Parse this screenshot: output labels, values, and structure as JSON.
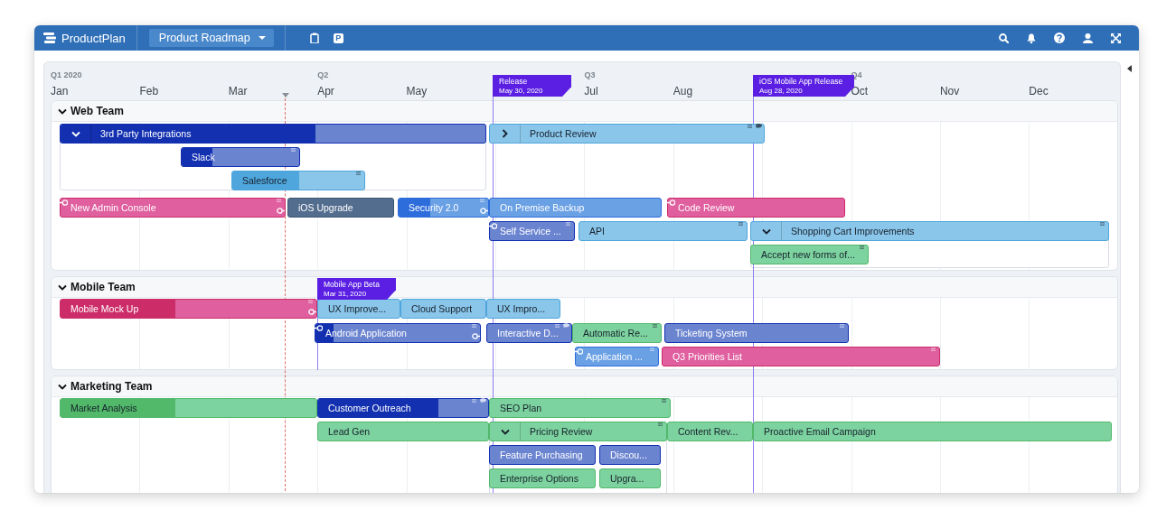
{
  "app": {
    "logo": "ProductPlan",
    "roadmap_menu": "Product Roadmap",
    "toolbar_badge": "P"
  },
  "timeline": {
    "quarters": [
      "Q1 2020",
      "Q2",
      "Q3",
      "Q4"
    ],
    "months": [
      "Jan",
      "Feb",
      "Mar",
      "Apr",
      "May",
      "Jul",
      "Aug",
      "Oct",
      "Nov",
      "Dec"
    ]
  },
  "milestones": [
    {
      "title": "Release",
      "date": "May 30, 2020"
    },
    {
      "title": "iOS Mobile App Release",
      "date": "Aug 28, 2020"
    },
    {
      "title": "Mobile App Beta",
      "date": "Mar 31, 2020"
    }
  ],
  "lanes": [
    {
      "name": "Web Team",
      "expanded": true,
      "bars": [
        {
          "label": "3rd Party Integrations",
          "color": "#6b84d0",
          "level": 0.6,
          "kind": "parent",
          "expanded": true
        },
        {
          "label": "Slack",
          "color": "#6b84d0",
          "level": 0.26,
          "kind": "bar",
          "handle": true
        },
        {
          "label": "Salesforce",
          "color": "#8ac6ea",
          "level": 0.51,
          "kind": "bar",
          "handle": true
        },
        {
          "label": "Product Review",
          "color": "#8ac6ea",
          "kind": "parent",
          "expanded": false,
          "handle": true,
          "comment": true
        },
        {
          "label": "New Admin Console",
          "color": "#df5f9f",
          "kind": "bar",
          "handle": true,
          "dependency_start": true,
          "dependency_end": true
        },
        {
          "label": "iOS Upgrade",
          "color": "#536d8f",
          "kind": "bar"
        },
        {
          "label": "Security 2.0",
          "color": "#6aa0e4",
          "level": 0.35,
          "kind": "bar",
          "handle": true,
          "dependency_end": true
        },
        {
          "label": "On Premise Backup",
          "color": "#6aa0e4",
          "kind": "bar"
        },
        {
          "label": "Code Review",
          "color": "#df5f9f",
          "kind": "bar",
          "dependency_start": true
        },
        {
          "label": "Self Service ...",
          "color": "#6b84d0",
          "kind": "bar",
          "handle": true,
          "dependency_start": true
        },
        {
          "label": "API",
          "color": "#8ac6ea",
          "kind": "bar",
          "handle": true
        },
        {
          "label": "Shopping Cart Improvements",
          "color": "#8ac6ea",
          "kind": "parent",
          "expanded": true,
          "handle": true
        },
        {
          "label": "Accept new forms of...",
          "color": "#7dd3a0",
          "kind": "bar",
          "handle": true
        }
      ]
    },
    {
      "name": "Mobile Team",
      "expanded": true,
      "bars": [
        {
          "label": "Mobile Mock Up",
          "color": "#df5f9f",
          "level": 0.45,
          "kind": "bar",
          "handle": true,
          "dependency_end": true
        },
        {
          "label": "UX Improve...",
          "color": "#8ac6ea",
          "kind": "bar"
        },
        {
          "label": "Cloud Support",
          "color": "#8ac6ea",
          "kind": "bar"
        },
        {
          "label": "UX Impro...",
          "color": "#8ac6ea",
          "kind": "bar"
        },
        {
          "label": "Android Application",
          "color": "#6b84d0",
          "level": 0.11,
          "kind": "bar",
          "handle": true,
          "dependency_start": true,
          "dependency_end": true
        },
        {
          "label": "Interactive D...",
          "color": "#6b84d0",
          "kind": "bar",
          "handle": true,
          "comment": true
        },
        {
          "label": "Automatic Re...",
          "color": "#7dd3a0",
          "kind": "bar",
          "handle": true
        },
        {
          "label": "Ticketing System",
          "color": "#6b84d0",
          "kind": "bar",
          "handle": true
        },
        {
          "label": "Application ...",
          "color": "#6aa0e4",
          "kind": "bar",
          "handle": true,
          "dependency_start": true
        },
        {
          "label": "Q3 Priorities List",
          "color": "#df5f9f",
          "kind": "bar",
          "handle": true
        }
      ]
    },
    {
      "name": "Marketing Team",
      "expanded": true,
      "bars": [
        {
          "label": "Market Analysis",
          "color": "#7dd3a0",
          "level": 0.45,
          "kind": "bar"
        },
        {
          "label": "Customer Outreach",
          "color": "#6b84d0",
          "level": 0.71,
          "kind": "bar",
          "handle": true,
          "comment": true
        },
        {
          "label": "SEO Plan",
          "color": "#7dd3a0",
          "kind": "bar",
          "handle": true
        },
        {
          "label": "Lead Gen",
          "color": "#7dd3a0",
          "kind": "bar"
        },
        {
          "label": "Pricing Review",
          "color": "#7dd3a0",
          "kind": "parent",
          "expanded": true,
          "handle": true
        },
        {
          "label": "Content Rev...",
          "color": "#7dd3a0",
          "kind": "bar"
        },
        {
          "label": "Proactive Email Campaign",
          "color": "#7dd3a0",
          "kind": "bar"
        },
        {
          "label": "Feature Purchasing",
          "color": "#6b84d0",
          "kind": "bar"
        },
        {
          "label": "Discou...",
          "color": "#6b84d0",
          "kind": "bar"
        },
        {
          "label": "Enterprise Options",
          "color": "#7dd3a0",
          "kind": "bar"
        },
        {
          "label": "Upgra...",
          "color": "#7dd3a0",
          "kind": "bar"
        }
      ]
    }
  ]
}
